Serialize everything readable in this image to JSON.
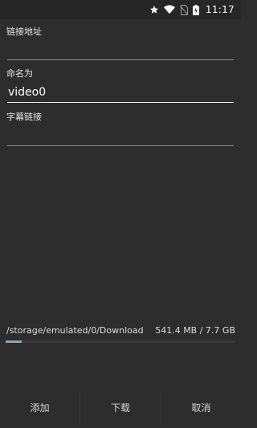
{
  "status_bar": {
    "time": "11:17",
    "icons": [
      "star-icon",
      "wifi-icon",
      "no-sim-icon",
      "battery-charging-icon"
    ]
  },
  "form": {
    "url_label": "链接地址",
    "url_value": "",
    "name_label": "命名为",
    "name_value": "video0",
    "subtitle_label": "字幕链接",
    "subtitle_value": ""
  },
  "storage": {
    "path": "/storage/emulated/0/Download",
    "size": "541.4 MB / 7.7 GB",
    "used_fraction": 0.069
  },
  "buttons": {
    "add": "添加",
    "download": "下载",
    "cancel": "取消"
  },
  "colors": {
    "background": "#2d2d2d",
    "status_bar": "#262626",
    "storage_fill": "#8fa4b8"
  }
}
